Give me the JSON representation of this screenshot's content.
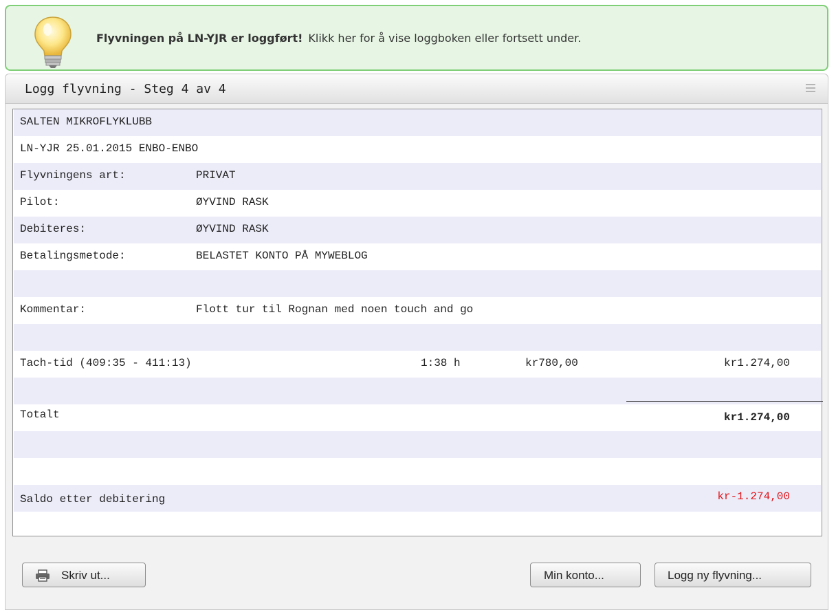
{
  "banner": {
    "bold_text": "Flyvningen på LN-YJR er loggført!",
    "text": "Klikk her for å vise loggboken eller fortsett under.",
    "icon": "lightbulb-icon"
  },
  "panel": {
    "title": "Logg flyvning - Steg 4 av 4"
  },
  "receipt": {
    "club": "SALTEN MIKROFLYKLUBB",
    "flight": "LN-YJR 25.01.2015 ENBO-ENBO",
    "fields": [
      {
        "label": "Flyvningens art:",
        "value": "PRIVAT"
      },
      {
        "label": "Pilot:",
        "value": "ØYVIND RASK"
      },
      {
        "label": "Debiteres:",
        "value": "ØYVIND RASK"
      },
      {
        "label": "Betalingsmetode:",
        "value": "BELASTET KONTO PÅ MYWEBLOG"
      }
    ],
    "comment": {
      "label": "Kommentar:",
      "value": "Flott tur til Rognan med noen touch and go"
    },
    "line_item": {
      "description": "Tach-tid (409:35 - 411:13)",
      "duration": "1:38 h",
      "rate": "kr780,00",
      "amount": "kr1.274,00"
    },
    "total": {
      "label": "Totalt",
      "amount": "kr1.274,00"
    },
    "balance": {
      "label": "Saldo etter debitering",
      "amount": "kr-1.274,00",
      "color": "#e0151a"
    }
  },
  "buttons": {
    "print": "Skriv ut...",
    "account": "Min konto...",
    "new_flight": "Logg ny flyvning..."
  },
  "colors": {
    "banner_bg": "#e7f6e4",
    "banner_border": "#7fcf77",
    "row_alt": "#ececf9",
    "negative": "#e0151a"
  }
}
